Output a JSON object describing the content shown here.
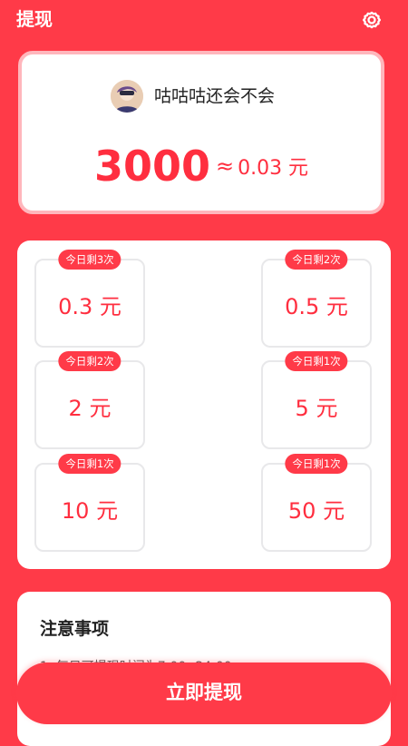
{
  "header": {
    "title": "提现",
    "settings_icon": "gear-icon"
  },
  "user": {
    "name": "咕咕咕还会不会",
    "coins": "3000",
    "approx_symbol": "≈",
    "cash": "0.03 元"
  },
  "options": [
    {
      "badge": "今日剩3次",
      "amount": "0.3 元"
    },
    {
      "badge": "今日剩2次",
      "amount": "0.5 元"
    },
    {
      "badge": "今日剩2次",
      "amount": "2 元"
    },
    {
      "badge": "今日剩1次",
      "amount": "5 元"
    },
    {
      "badge": "今日剩1次",
      "amount": "10 元"
    },
    {
      "badge": "今日剩1次",
      "amount": "50 元"
    }
  ],
  "notes": {
    "title": "注意事项",
    "line1": "1. 每日可提现时间为7:00--24:00"
  },
  "actions": {
    "withdraw_label": "立即提现"
  },
  "colors": {
    "primary": "#ff3a48",
    "amount_red": "#ff2e3f",
    "card_border": "#ffb6bc"
  }
}
